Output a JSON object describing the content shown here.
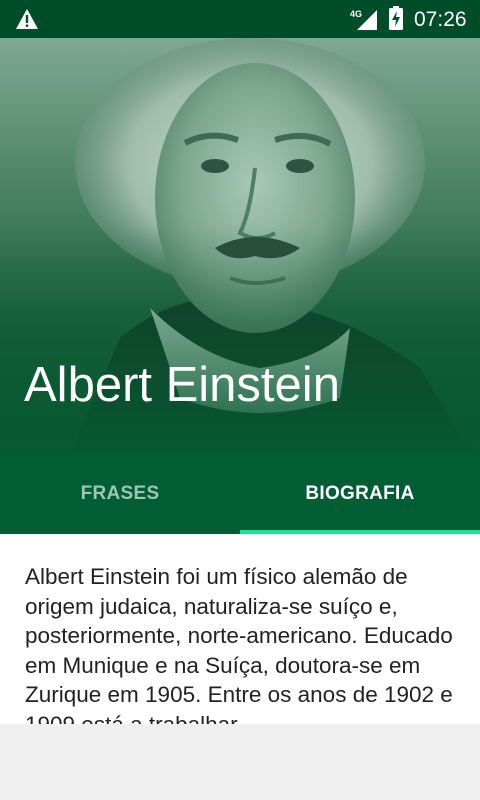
{
  "status_bar": {
    "time": "07:26",
    "network": "4G",
    "icons": [
      "warning-icon",
      "signal-icon",
      "battery-charging-icon"
    ]
  },
  "header": {
    "title": "Albert Einstein"
  },
  "tabs": [
    {
      "label": "FRASES",
      "selected": false
    },
    {
      "label": "BIOGRAFIA",
      "selected": true
    }
  ],
  "biography": {
    "text": "Albert Einstein foi um físico alemão de origem judaica, naturaliza-se suíço e, posteriormente, norte-americano. Educado em Munique e na Suíça, doutora-se em Zurique em 1905. Entre os anos de 1902 e 1909 está a trabalhar"
  },
  "colors": {
    "primary_dark": "#004d29",
    "primary": "#005d34",
    "accent": "#1ee090"
  }
}
